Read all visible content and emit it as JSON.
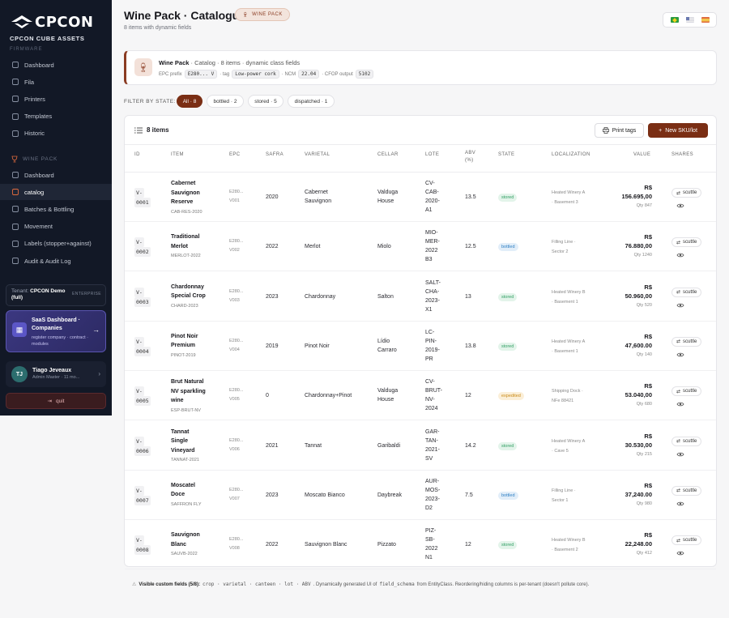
{
  "brand": {
    "logo_text": "CPCON",
    "sub": "CPCON CUBE ASSETS",
    "clipped": "FIRMWARE"
  },
  "sidebar": {
    "top_items": [
      {
        "label": "Dashboard",
        "icon": "dashboard-icon"
      },
      {
        "label": "Fila",
        "icon": "queue-icon"
      },
      {
        "label": "Printers",
        "icon": "printer-icon"
      },
      {
        "label": "Templates",
        "icon": "template-icon"
      },
      {
        "label": "Historic",
        "icon": "history-icon"
      }
    ],
    "section_label": "WINE PACK",
    "wine_items": [
      {
        "label": "Dashboard",
        "icon": "dashboard-icon"
      },
      {
        "label": "catalog",
        "icon": "catalog-icon",
        "active": true
      },
      {
        "label": "Batches & Bottling",
        "icon": "layers-icon"
      },
      {
        "label": "Movement",
        "icon": "movement-icon"
      },
      {
        "label": "Labels (stopper+against)",
        "icon": "label-icon"
      },
      {
        "label": "Audit & Audit Log",
        "icon": "audit-icon"
      }
    ],
    "tenant": {
      "prefix": "Tenant:",
      "name": "CPCON Demo",
      "plan": "ENTERPRISE",
      "mode": "(full)"
    },
    "saas": {
      "title": "SaaS Dashboard · Companies",
      "desc": "register company · contract · modules"
    },
    "user": {
      "initials": "TJ",
      "name": "Tiago Jeveaux",
      "role": "Admin Master · 11 mo..."
    },
    "quit": "quit"
  },
  "header": {
    "title": "Wine Pack · Catalogue",
    "badge": "WINE PACK",
    "subtitle": "8 items with dynamic fields"
  },
  "info": {
    "title": "Wine Pack",
    "desc": " · Catalog · 8 items · dynamic class fields",
    "epc_label": "EPC prefix",
    "epc_value": "E280... V",
    "tag_label": "· tag",
    "tag_value": "Low-power cork",
    "ncm_label": "· NCM",
    "ncm_value": "22.04",
    "cfop_label": "· CFOP output",
    "cfop_value": "5102"
  },
  "filters": {
    "label": "FILTER BY STATE:",
    "chips": [
      "All · 8",
      "bottled · 2",
      "stored · 5",
      "dispatched · 1"
    ]
  },
  "table": {
    "count_label": "8 items",
    "print_label": "Print tags",
    "new_label": "New SKU/lot",
    "columns": [
      "ID",
      "ITEM",
      "EPC",
      "SAFRA",
      "VARIETAL",
      "CELLAR",
      "LOTE",
      "ABV (%)",
      "STATE",
      "LOCALIZATION",
      "VALUE",
      "SHARES"
    ],
    "share_label": "scuttle",
    "rows": [
      {
        "id1": "V-",
        "id2": "0001",
        "name": [
          "Cabernet",
          "Sauvignon",
          "Reserve"
        ],
        "code": "CAB-RES-2020",
        "epc1": "E280...",
        "epc2": "V001",
        "safra": "2020",
        "varietal": [
          "Cabernet",
          "Sauvignon"
        ],
        "cellar": [
          "Valduga",
          "House"
        ],
        "lote": [
          "CV-",
          "CAB-",
          "2020-",
          "A1"
        ],
        "abv": "13.5",
        "state": "stored",
        "loc": [
          "Heated Winery A",
          "· Basement 3"
        ],
        "value": "R$ 156.695,00",
        "qty": "Qty 847"
      },
      {
        "id1": "V-",
        "id2": "0002",
        "name": [
          "Traditional",
          "Merlot"
        ],
        "code": "MERLOT-2022",
        "epc1": "E280...",
        "epc2": "V002",
        "safra": "2022",
        "varietal": [
          "Merlot"
        ],
        "cellar": [
          "Miolo"
        ],
        "lote": [
          "MIO-",
          "MER-",
          "2022",
          "B3"
        ],
        "abv": "12.5",
        "state": "bottled",
        "loc": [
          "Filling Line ·",
          "Sector 2"
        ],
        "value": "R$ 76.880,00",
        "qty": "Qty 1240"
      },
      {
        "id1": "V-",
        "id2": "0003",
        "name": [
          "Chardonnay",
          "Special Crop"
        ],
        "code": "CHARD-2023",
        "epc1": "E280...",
        "epc2": "V003",
        "safra": "2023",
        "varietal": [
          "Chardonnay"
        ],
        "cellar": [
          "Salton"
        ],
        "lote": [
          "SALT-",
          "CHA-",
          "2023-",
          "X1"
        ],
        "abv": "13",
        "state": "stored",
        "loc": [
          "Heated Winery B",
          "· Basement 1"
        ],
        "value": "R$ 50.960,00",
        "qty": "Qty 520"
      },
      {
        "id1": "V-",
        "id2": "0004",
        "name": [
          "Pinot Noir",
          "Premium"
        ],
        "code": "PINOT-2019",
        "epc1": "E280...",
        "epc2": "V004",
        "safra": "2019",
        "varietal": [
          "Pinot Noir"
        ],
        "cellar": [
          "Lídio",
          "Carraro"
        ],
        "lote": [
          "LC-",
          "PIN-",
          "2019-",
          "PR"
        ],
        "abv": "13.8",
        "state": "stored",
        "loc": [
          "Heated Winery A",
          "· Basement 1"
        ],
        "value": "R$ 47,600.00",
        "qty": "Qty 140"
      },
      {
        "id1": "V-",
        "id2": "0005",
        "name": [
          "Brut Natural",
          "NV sparkling",
          "wine"
        ],
        "code": "ESP-BRUT-NV",
        "epc1": "E280...",
        "epc2": "V005",
        "safra": "0",
        "varietal": [
          "Chardonnay+Pinot"
        ],
        "cellar": [
          "Valduga",
          "House"
        ],
        "lote": [
          "CV-",
          "BRUT-",
          "NV-",
          "2024"
        ],
        "abv": "12",
        "state": "expedited",
        "loc": [
          "Shipping Dock ·",
          "NFe 88421"
        ],
        "value": "R$ 53.040,00",
        "qty": "Qty 680"
      },
      {
        "id1": "V-",
        "id2": "0006",
        "name": [
          "Tannat",
          "Single",
          "Vineyard"
        ],
        "code": "TANNAT-2021",
        "epc1": "E280...",
        "epc2": "V006",
        "safra": "2021",
        "varietal": [
          "Tannat"
        ],
        "cellar": [
          "Garibaldi"
        ],
        "lote": [
          "GAR-",
          "TAN-",
          "2021-",
          "SV"
        ],
        "abv": "14.2",
        "state": "stored",
        "loc": [
          "Heated Winery A",
          "· Cave 5"
        ],
        "value": "R$ 30.530,00",
        "qty": "Qty 215"
      },
      {
        "id1": "V-",
        "id2": "0007",
        "name": [
          "Moscatel",
          "Doce"
        ],
        "code": "SAFFRON FLY",
        "epc1": "E280...",
        "epc2": "V007",
        "safra": "2023",
        "varietal": [
          "Moscato Bianco"
        ],
        "cellar": [
          "Daybreak"
        ],
        "lote": [
          "AUR-",
          "MOS-",
          "2023-",
          "D2"
        ],
        "abv": "7.5",
        "state": "bottled",
        "loc": [
          "Filling Line ·",
          "Sector 1"
        ],
        "value": "R$ 37,240.00",
        "qty": "Qty 980"
      },
      {
        "id1": "V-",
        "id2": "0008",
        "name": [
          "Sauvignon",
          "Blanc"
        ],
        "code": "SAUVB-2022",
        "epc1": "E280...",
        "epc2": "V008",
        "safra": "2022",
        "varietal": [
          "Sauvignon Blanc"
        ],
        "cellar": [
          "Pizzato"
        ],
        "lote": [
          "PIZ-",
          "SB-",
          "2022",
          "N1"
        ],
        "abv": "12",
        "state": "stored",
        "loc": [
          "Heated Winery B",
          "· Basement 2"
        ],
        "value": "R$ 22,248.00",
        "qty": "Qty 412"
      }
    ]
  },
  "footnote": {
    "bold": "Visible custom fields (5/8):",
    "fields": "crop · varietal · canteen · lot · ABV",
    "mid": ". Dynamically generated UI of",
    "schema": "field_schema",
    "rest": "from EntityClass. Reordering/hiding columns is per-tenant (doesn't pollute core)."
  },
  "colors": {
    "accent": "#7a2e14",
    "sidebar_bg": "#121826",
    "stored": "#2f9e62",
    "bottled": "#2e7fc4",
    "expedited": "#c98a16"
  }
}
